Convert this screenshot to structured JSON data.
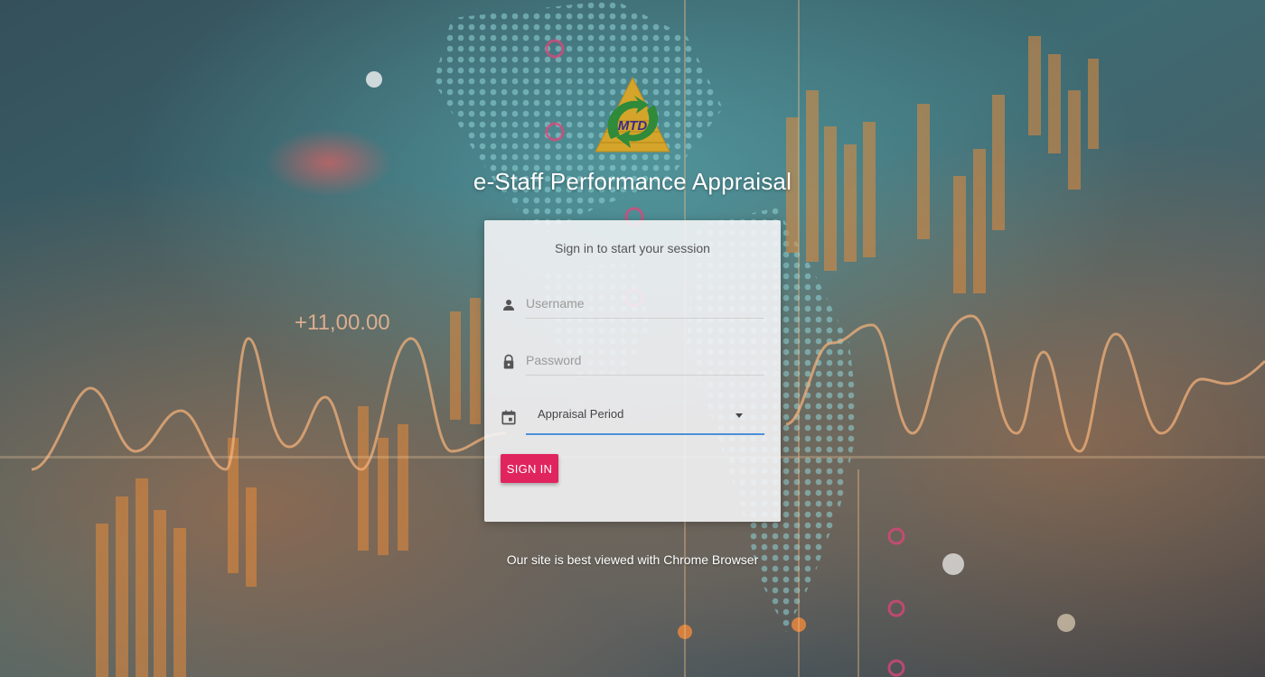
{
  "app": {
    "title": "e-Staff Performance Appraisal",
    "logo_text": "MTD"
  },
  "background": {
    "overlay_text": "+11,00.00"
  },
  "login": {
    "heading": "Sign in to start your session",
    "username": {
      "placeholder": "Username",
      "value": "",
      "icon": "person-icon"
    },
    "password": {
      "placeholder": "Password",
      "value": "",
      "icon": "lock-icon"
    },
    "period": {
      "selected": "Appraisal Period",
      "icon": "calendar-icon"
    },
    "signin_label": "SIGN IN"
  },
  "footer": {
    "note": "Our site is best viewed with Chrome Browser"
  },
  "colors": {
    "accent": "#e0245e",
    "focus_underline": "#4a90d9",
    "logo_gold": "#d4a52a",
    "logo_green": "#2f8a3a"
  }
}
